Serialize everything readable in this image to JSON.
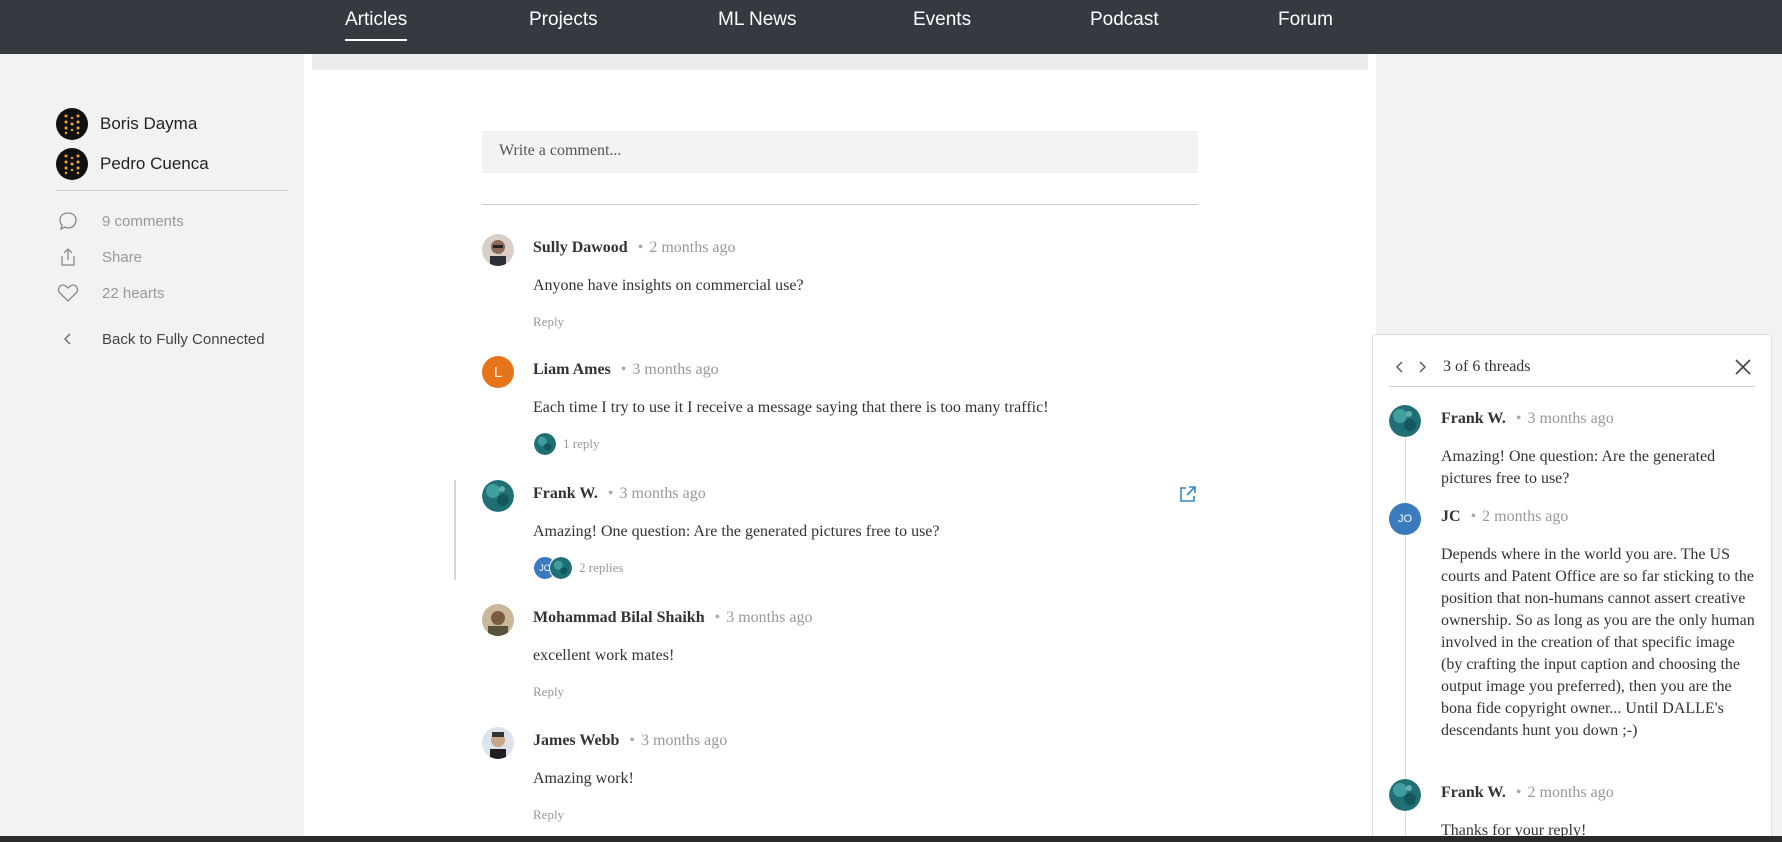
{
  "nav": {
    "items": [
      {
        "label": "Articles",
        "active": true
      },
      {
        "label": "Projects"
      },
      {
        "label": "ML News"
      },
      {
        "label": "Events"
      },
      {
        "label": "Podcast"
      },
      {
        "label": "Forum"
      }
    ]
  },
  "sidebar": {
    "authors": [
      {
        "name": "Boris Dayma"
      },
      {
        "name": "Pedro Cuenca"
      }
    ],
    "actions": {
      "comments": "9 comments",
      "share": "Share",
      "hearts": "22 hearts"
    },
    "back_label": "Back to Fully Connected"
  },
  "main": {
    "comment_placeholder": "Write a comment...",
    "comments": [
      {
        "author": "Sully Dawood",
        "time": "2 months ago",
        "text": "Anyone have insights on commercial use?",
        "reply": "Reply"
      },
      {
        "author": "Liam Ames",
        "time": "3 months ago",
        "avatar_initial": "L",
        "text": "Each time I try to use it I receive a message saying that there is too many traffic!",
        "replies": "1 reply"
      },
      {
        "author": "Frank W.",
        "time": "3 months ago",
        "text": "Amazing! One question: Are the generated pictures free to use?",
        "replies": "2 replies",
        "mini_avatar_initials": "JO"
      },
      {
        "author": "Mohammad Bilal Shaikh",
        "time": "3 months ago",
        "text": "excellent work mates!",
        "reply": "Reply"
      },
      {
        "author": "James Webb",
        "time": "3 months ago",
        "text": "Amazing work!",
        "reply": "Reply"
      }
    ]
  },
  "panel": {
    "count": "3 of 6 threads",
    "comments": [
      {
        "author": "Frank W.",
        "time": "3 months ago",
        "text": "Amazing! One question: Are the generated pictures free to use?"
      },
      {
        "author": "JC",
        "avatar_initials": "JO",
        "time": "2 months ago",
        "text": "Depends where in the world you are. The US courts and Patent Office are so far sticking to the position that non-humans cannot assert creative ownership. So as long as you are the only human involved in the creation of that specific image (by crafting the input caption and choosing the output image you preferred), then you are the bona fide copyright owner... Until DALLE's descendants hunt you down ;-)"
      },
      {
        "author": "Frank W.",
        "time": "2 months ago",
        "text": "Thanks for your reply!"
      }
    ]
  },
  "colors": {
    "nav_bg": "#343a40",
    "orange_avatar": "#e8741a",
    "blue_avatar": "#3a7bbf",
    "link_blue": "#3a86c8"
  }
}
